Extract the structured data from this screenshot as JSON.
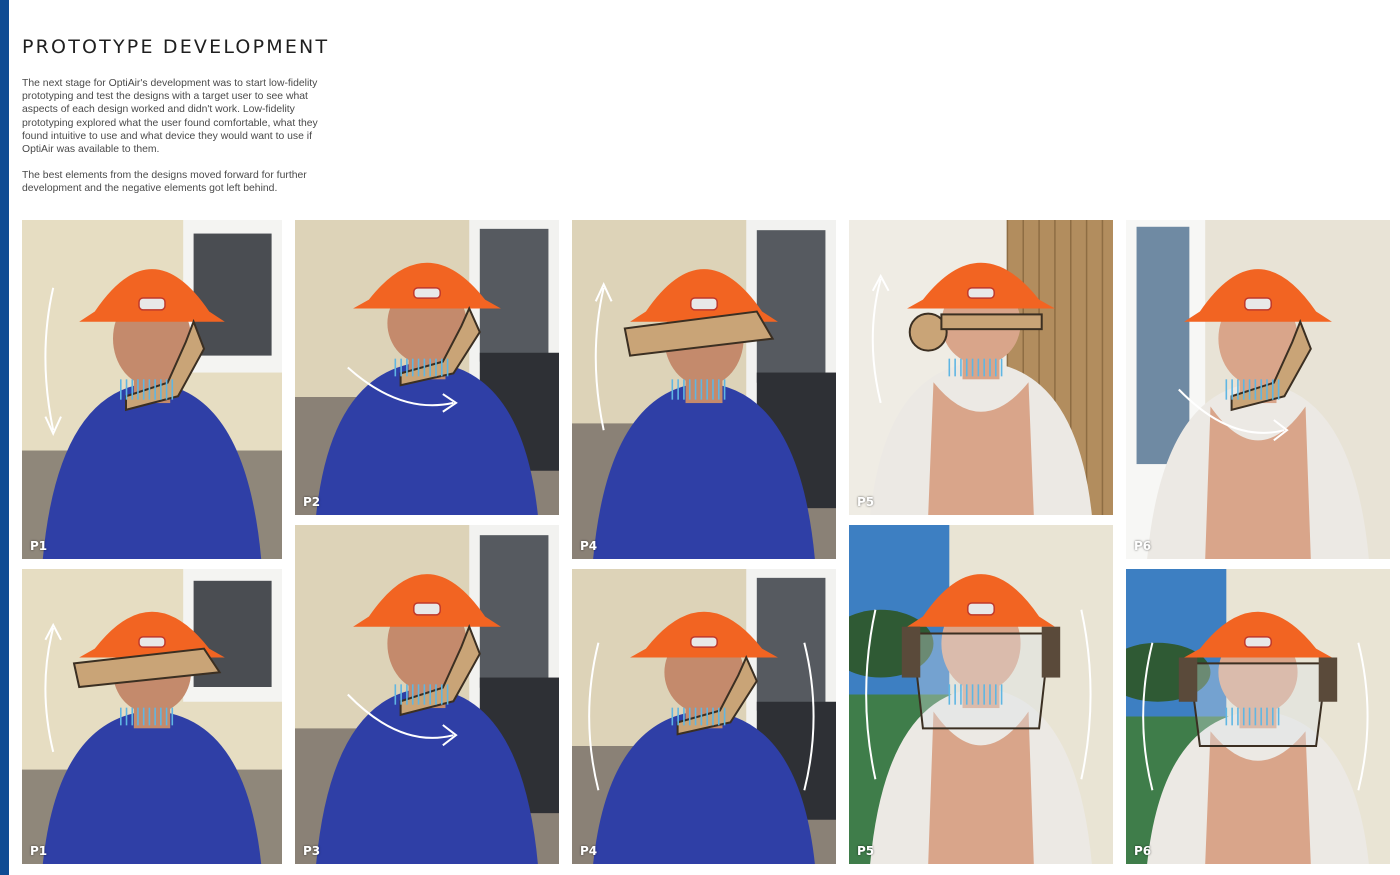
{
  "page": {
    "title": "PROTOTYPE DEVELOPMENT",
    "paragraphs": [
      "The next stage for OptiAir's development was to start low-fidelity prototyping and test the designs with a target user to see what aspects of each design worked and didn't work. Low-fidelity prototyping explored what the user found comfortable, what they found intuitive to use and what device they would want to use if OptiAir was available to them.",
      "The best elements from the designs moved forward for further development and the negative elements got left behind."
    ]
  },
  "colors": {
    "accent_bar": "#0f4b93",
    "helmet": "#f26422",
    "cardboard": "#c9a477",
    "shirt_blue": "#2f3fa6",
    "breath_lines": "#5fb6e3"
  },
  "photos": [
    {
      "label": "P1",
      "subject": "man",
      "scene": "wall-side",
      "prototype": "chin-strap",
      "arrow": "down"
    },
    {
      "label": "P1",
      "subject": "man",
      "scene": "wall-side",
      "prototype": "visor",
      "arrow": "up"
    },
    {
      "label": "P2",
      "subject": "man",
      "scene": "patio",
      "prototype": "side-arm",
      "arrow": "swing"
    },
    {
      "label": "P3",
      "subject": "man",
      "scene": "patio",
      "prototype": "chin-strap",
      "arrow": "diagonal"
    },
    {
      "label": "P4",
      "subject": "man",
      "scene": "patio",
      "prototype": "visor-flap",
      "arrow": "up"
    },
    {
      "label": "P4",
      "subject": "man",
      "scene": "patio",
      "prototype": "side-arm",
      "arrow": "double"
    },
    {
      "label": "P5",
      "subject": "woman",
      "scene": "wood-door",
      "prototype": "side-ear",
      "arrow": "up"
    },
    {
      "label": "P5",
      "subject": "woman",
      "scene": "garden",
      "prototype": "face-shield",
      "arrow": "double"
    },
    {
      "label": "P6",
      "subject": "woman",
      "scene": "window",
      "prototype": "chin-strap",
      "arrow": "curve"
    },
    {
      "label": "P6",
      "subject": "woman",
      "scene": "garden",
      "prototype": "face-shield",
      "arrow": "double"
    }
  ]
}
